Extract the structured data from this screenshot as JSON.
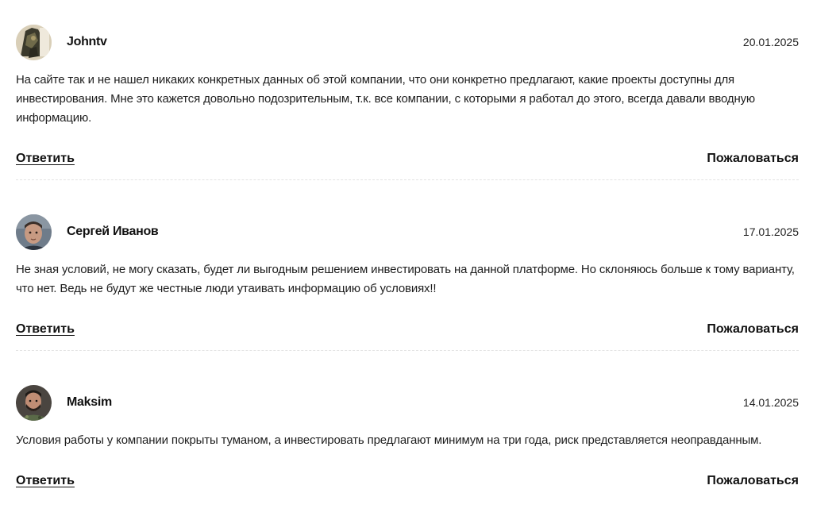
{
  "reviews": [
    {
      "author": "Johntv",
      "date": "20.01.2025",
      "text": "На сайте так и не нашел никаких конкретных данных об этой компании, что они конкретно предлагают, какие проекты доступны для инвестирования. Мне это кажется довольно подозрительным, т.к. все компании, с которыми я работал до этого, всегда давали вводную информацию.",
      "reply_label": "Ответить",
      "complain_label": "Пожаловаться",
      "avatar_icon": "user-photo-icon"
    },
    {
      "author": "Сергей Иванов",
      "date": "17.01.2025",
      "text": "Не зная условий, не могу сказать, будет ли выгодным решением инвестировать на данной платформе. Но склоняюсь больше к тому варианту, что нет. Ведь не будут же честные люди утаивать информацию об условиях!!",
      "reply_label": "Ответить",
      "complain_label": "Пожаловаться",
      "avatar_icon": "user-photo-icon"
    },
    {
      "author": "Maksim",
      "date": "14.01.2025",
      "text": "Условия работы у компании покрыты туманом, а инвестировать предлагают минимум на три года, риск представляется неоправданным.",
      "reply_label": "Ответить",
      "complain_label": "Пожаловаться",
      "avatar_icon": "user-photo-icon"
    }
  ]
}
